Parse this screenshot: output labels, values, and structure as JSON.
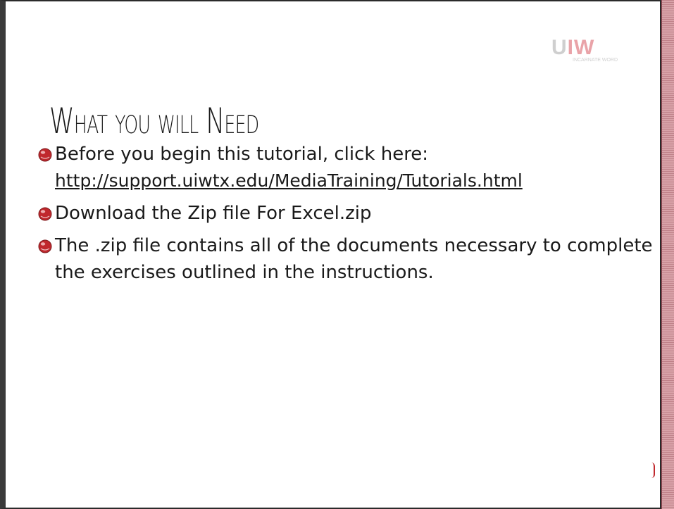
{
  "slide": {
    "title": "What you will Need",
    "logo": {
      "mark_light": "U",
      "mark_accent": "IW",
      "subtext": "INCARNATE WORD"
    },
    "bullets": [
      {
        "text": "Before you begin this tutorial, click here:",
        "link": "http://support.uiwtx.edu/MediaTraining/Tutorials.html"
      },
      {
        "text": "Download the Zip file For Excel.zip"
      },
      {
        "text": "The .zip file contains all of the documents necessary to complete the exercises outlined in the instructions."
      }
    ],
    "colors": {
      "bullet": "#c0282d",
      "frame": "#3a3a3a",
      "accent_edge": "#c0828a"
    },
    "icons": {
      "bullet": "sphere-bullet-icon"
    }
  }
}
